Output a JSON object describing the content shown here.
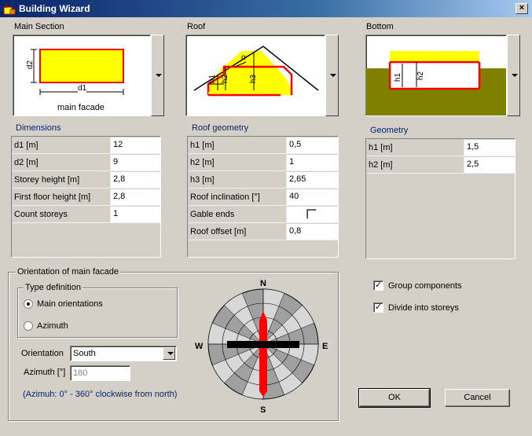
{
  "window": {
    "title": "Building Wizard",
    "close_label": "×"
  },
  "previews": {
    "main_section": {
      "label": "Main Section",
      "d1": "d1",
      "d2": "d2",
      "caption": "main facade"
    },
    "roof": {
      "label": "Roof",
      "h1": "h1",
      "h2": "h2",
      "h3": "h3",
      "angle": "α"
    },
    "bottom": {
      "label": "Bottom",
      "h1": "h1",
      "h2": "h2"
    }
  },
  "dimensions": {
    "title": "Dimensions",
    "rows": [
      {
        "key": "d1  [m]",
        "value": "12"
      },
      {
        "key": "d2  [m]",
        "value": "9"
      },
      {
        "key": "Storey height  [m]",
        "value": "2,8"
      },
      {
        "key": "First floor height  [m]",
        "value": "2,8"
      },
      {
        "key": "Count storeys",
        "value": "1"
      }
    ]
  },
  "roof_geometry": {
    "title": "Roof geometry",
    "rows": [
      {
        "key": "h1  [m]",
        "value": "0,5"
      },
      {
        "key": "h2  [m]",
        "value": "1"
      },
      {
        "key": "h3  [m]",
        "value": "2,65"
      },
      {
        "key": "Roof inclination  [°]",
        "value": "40"
      },
      {
        "key": "Gable ends",
        "value": ""
      },
      {
        "key": "Roof offset  [m]",
        "value": "0,8"
      }
    ]
  },
  "geometry": {
    "title": "Geometry",
    "rows": [
      {
        "key": "h1  [m]",
        "value": "1,5"
      },
      {
        "key": "h2  [m]",
        "value": "2,5"
      }
    ]
  },
  "orientation": {
    "title": "Orientation of main facade",
    "type_definition": "Type definition",
    "radio_main": "Main orientations",
    "radio_azimuth": "Azimuth",
    "orientation_label": "Orientation",
    "orientation_value": "South",
    "azimuth_label": "Azimuth [°]",
    "azimuth_value": "180",
    "hint": "(Azimuh: 0° - 360° clockwise from north)",
    "compass": {
      "n": "N",
      "s": "S",
      "e": "E",
      "w": "W"
    }
  },
  "options": {
    "group_components": "Group components",
    "divide_storeys": "Divide into storeys"
  },
  "buttons": {
    "ok": "OK",
    "cancel": "Cancel"
  },
  "colors": {
    "accent_red": "#ff0000",
    "fill_yellow": "#ffff00",
    "ground_olive": "#808000",
    "title_blue": "#0a246a"
  }
}
